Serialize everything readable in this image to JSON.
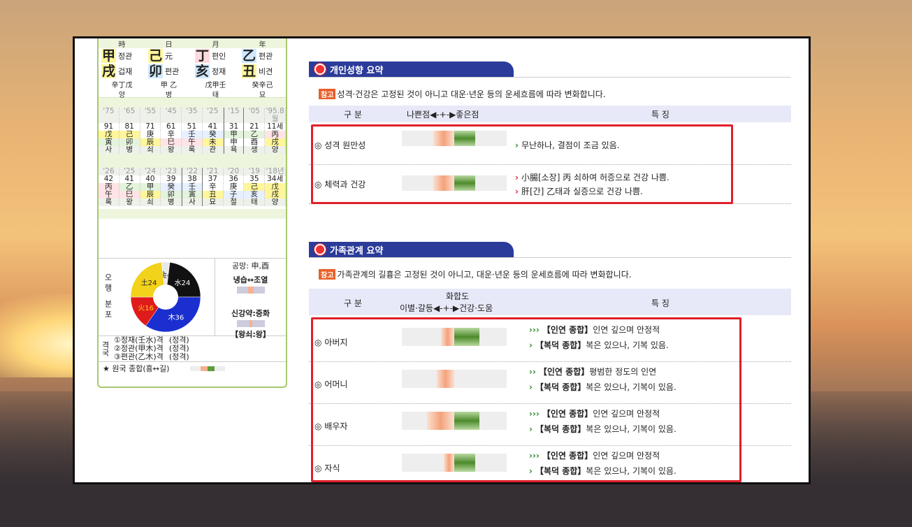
{
  "left": {
    "pillars_head": [
      "時",
      "日",
      "月",
      "年"
    ],
    "stems": [
      {
        "big": "甲",
        "label": "정관",
        "hl": "y"
      },
      {
        "big": "己",
        "label": "元",
        "hl": "y"
      },
      {
        "big": "丁",
        "label": "편인",
        "hl": "p"
      },
      {
        "big": "乙",
        "label": "편관",
        "hl": "b"
      }
    ],
    "branches": [
      {
        "big": "戌",
        "label": "겁재",
        "hl": "y"
      },
      {
        "big": "卯",
        "label": "편관",
        "hl": "b"
      },
      {
        "big": "亥",
        "label": "정재",
        "hl": "b"
      },
      {
        "big": "丑",
        "label": "비견",
        "hl": "y"
      }
    ],
    "hidden": [
      "辛丁戊",
      "甲 乙",
      "戊甲壬",
      "癸辛己"
    ],
    "stage": [
      "양",
      "병",
      "태",
      "묘"
    ],
    "luck_ages": [
      "'75",
      "'65",
      "'55",
      "'45",
      "'35",
      "'25",
      "'15",
      "'05",
      "'95.8월"
    ],
    "luck_nums": [
      "91",
      "81",
      "71",
      "61",
      "51",
      "41",
      "31",
      "21",
      "11세"
    ],
    "luck_stems": [
      "戊",
      "己",
      "庚",
      "辛",
      "壬",
      "癸",
      "甲",
      "乙",
      "丙"
    ],
    "luck_branches": [
      "寅",
      "卯",
      "辰",
      "巳",
      "午",
      "未",
      "申",
      "酉",
      "戌"
    ],
    "luck_stage": [
      "사",
      "병",
      "쇠",
      "왕",
      "록",
      "관",
      "욕",
      "생",
      "양"
    ],
    "year_ages": [
      "'26",
      "'25",
      "'24",
      "'23",
      "'22",
      "'21",
      "'20",
      "'19",
      "'18년"
    ],
    "year_nums": [
      "42",
      "41",
      "40",
      "39",
      "38",
      "37",
      "36",
      "35",
      "34세"
    ],
    "year_stems": [
      "丙",
      "乙",
      "甲",
      "癸",
      "壬",
      "辛",
      "庚",
      "己",
      "戊"
    ],
    "year_branches": [
      "午",
      "巳",
      "辰",
      "卯",
      "寅",
      "丑",
      "子",
      "亥",
      "戌"
    ],
    "year_stage": [
      "록",
      "왕",
      "쇠",
      "병",
      "사",
      "묘",
      "절",
      "태",
      "양"
    ],
    "ohaeng_label": "오행",
    "bunpo_label": "분포",
    "pie": [
      {
        "name": "金4",
        "value": 4,
        "color": "#e8e8e8"
      },
      {
        "name": "水24",
        "value": 24,
        "color": "#111111"
      },
      {
        "name": "木36",
        "value": 36,
        "color": "#1b2fd0"
      },
      {
        "name": "火16",
        "value": 16,
        "color": "#e01b1b"
      },
      {
        "name": "土24",
        "value": 24,
        "color": "#f2d21a"
      }
    ],
    "gongmang": "공망: 申,酉",
    "naengseup": "냉습↔조열",
    "singangyak": "신강약:중화",
    "wangsoe": "【왕쇠:왕】",
    "gyeok_label": "격국",
    "gyeok": [
      {
        "name": "①정재(壬水)격",
        "type": "(정격)"
      },
      {
        "name": "②정관(甲木)격",
        "type": "(정격)"
      },
      {
        "name": "③편관(乙木)격",
        "type": "(정격)"
      }
    ],
    "total": "★ 원국 종합(흉↔길)"
  },
  "personality": {
    "title": "개인성향 요약",
    "note_tag": "참고",
    "note": "성격·건강은 고정된 것이 아니고 대운·년운 등의 운세흐름에 따라 변화합니다.",
    "head_gubun": "구 분",
    "head_scale": "나쁜점◀-+-▶좋은점",
    "head_feature": "특 징",
    "rows": [
      {
        "label": "◎ 성격 원만성",
        "lines": [
          {
            "mark": "›",
            "text": "무난하나, 결점이 조금 있음."
          }
        ],
        "bad": 0.2,
        "good": 0.2
      },
      {
        "label": "◎ 체력과 건강",
        "lines": [
          {
            "mark": "›",
            "text": "小腸[소장] 丙 쇠하여 허증으로 건강 나쁨."
          },
          {
            "mark": "›",
            "text": "肝[간] 乙태과 실증으로 건강 나쁨."
          }
        ],
        "bad": 0.2,
        "good": 0.2
      }
    ]
  },
  "family": {
    "title": "가족관계 요약",
    "note_tag": "참고",
    "note": "가족관계의 길흉은 고정된 것이 아니고, 대운·년운 등의 운세흐름에 따라 변화합니다.",
    "head_gubun": "구 분",
    "head_scale_1": "화합도",
    "head_scale_2": "이별·갈등◀-+-▶건강·도움",
    "head_feature": "특 징",
    "rows": [
      {
        "label": "◎ 아버지",
        "l1mark": "›››",
        "l1tag": "【인연 종합】",
        "l1": "인연 깊으며 안정적",
        "l2mark": "›",
        "l2tag": "【복덕 종합】",
        "l2": "복은 있으나, 기복 있음.",
        "bad": 0.13,
        "good": 0.24
      },
      {
        "label": "◎ 어머니",
        "l1mark": "››",
        "l1tag": "【인연 종합】",
        "l1": "평범한 정도의 인연",
        "l2mark": "›",
        "l2tag": "【복덕 종합】",
        "l2": "복은 있으나, 기복이 있음.",
        "bad": 0.17,
        "good": 0.0
      },
      {
        "label": "◎ 배우자",
        "l1mark": "›››",
        "l1tag": "【인연 종합】",
        "l1": "인연 깊으며 안정적",
        "l2mark": "›",
        "l2tag": "【복덕 종합】",
        "l2": "복은 있으나, 기복이 있음.",
        "bad": 0.26,
        "good": 0.24
      },
      {
        "label": "◎ 자식",
        "l1mark": "›››",
        "l1tag": "【인연 종합】",
        "l1": "인연 깊으며 안정적",
        "l2mark": "›",
        "l2tag": "【복덕 종합】",
        "l2": "복은 있으나, 기복이 있음.",
        "bad": 0.1,
        "good": 0.2
      }
    ]
  }
}
